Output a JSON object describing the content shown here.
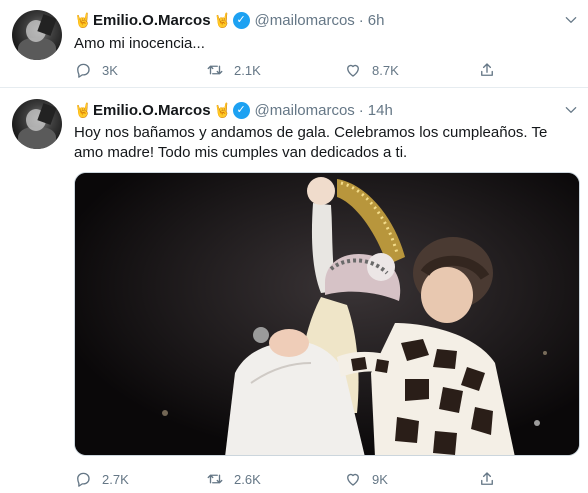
{
  "tweets": [
    {
      "author_name": "Emilio.O.Marcos",
      "emoji_left": "🤘",
      "emoji_right": "🤘",
      "handle": "@mailomarcos",
      "separator": "·",
      "time": "6h",
      "text": "Amo mi inocencia...",
      "replies": "3K",
      "retweets": "2.1K",
      "likes": "8.7K"
    },
    {
      "author_name": "Emilio.O.Marcos",
      "emoji_left": "🤘",
      "emoji_right": "🤘",
      "handle": "@mailomarcos",
      "separator": "·",
      "time": "14h",
      "text": "Hoy nos bañamos y andamos de gala. Celebramos los cumpleaños. Te amo madre! Todo mis cumples van dedicados a ti.",
      "replies": "2.7K",
      "retweets": "2.6K",
      "likes": "9K"
    }
  ],
  "colors": {
    "verified": "#1da1f2",
    "secondary_text": "#657786",
    "divider": "#e6ecf0"
  },
  "icons": [
    "chevron-down-icon",
    "verified-badge-icon",
    "reply-icon",
    "retweet-icon",
    "like-icon",
    "share-icon",
    "rock-hand-emoji"
  ]
}
